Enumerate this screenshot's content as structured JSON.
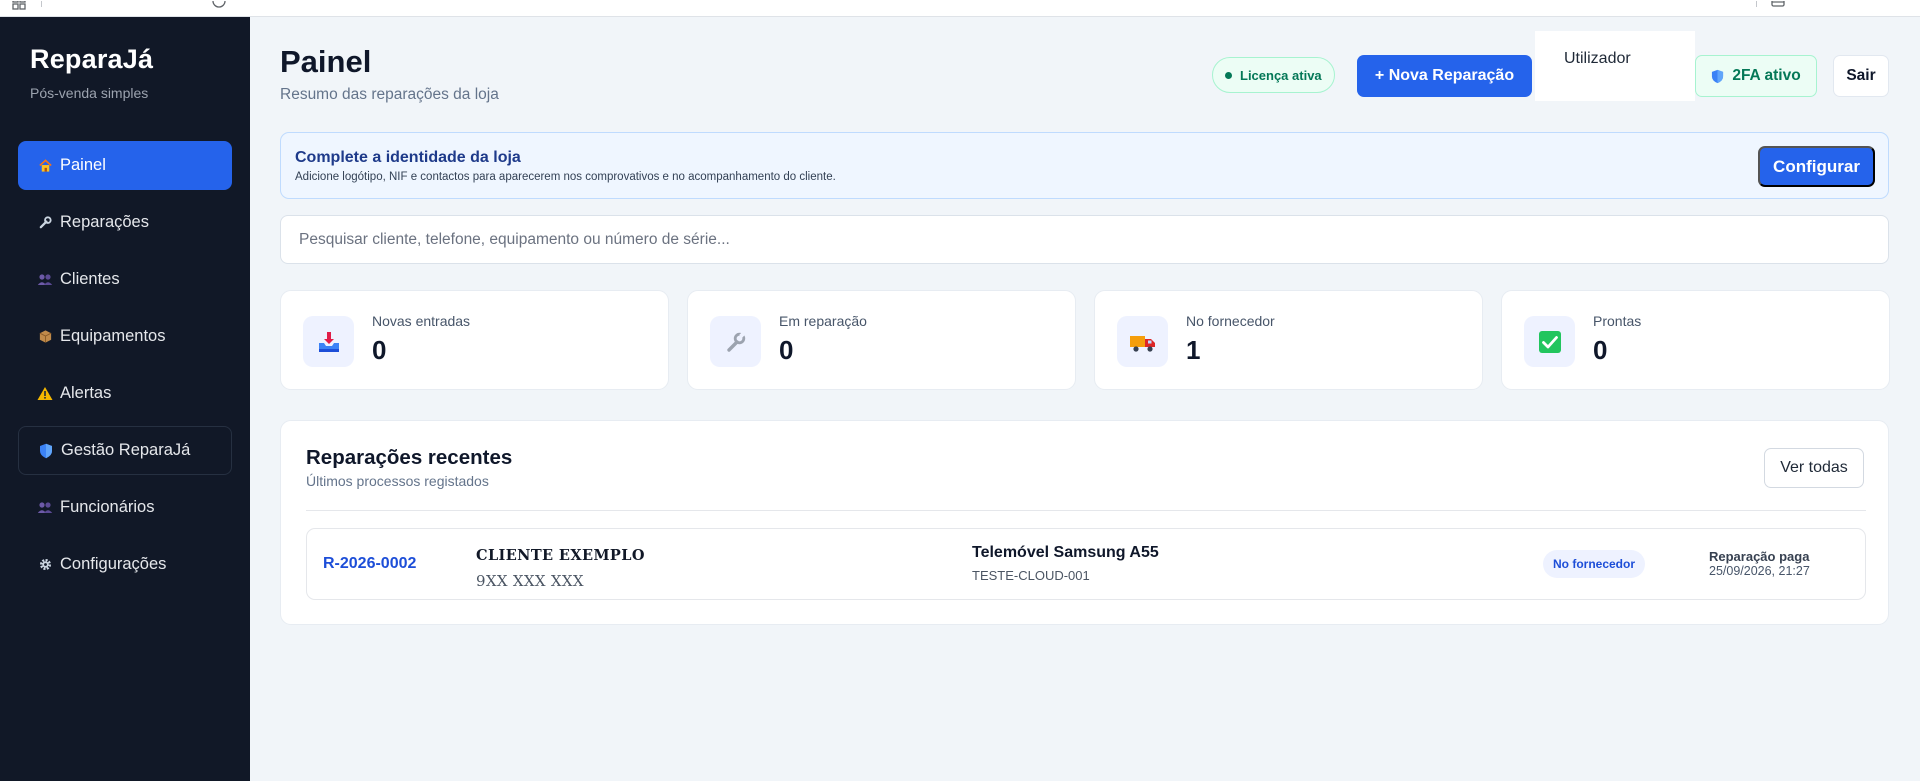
{
  "app": {
    "brand": "ReparaJá",
    "tagline": "Pós-venda simples"
  },
  "sidebar": {
    "items": [
      {
        "label": "Painel",
        "icon": "house-icon"
      },
      {
        "label": "Reparações",
        "icon": "wrench-icon"
      },
      {
        "label": "Clientes",
        "icon": "people-icon"
      },
      {
        "label": "Equipamentos",
        "icon": "package-icon"
      },
      {
        "label": "Alertas",
        "icon": "warning-icon"
      },
      {
        "label": "Gestão ReparaJá",
        "icon": "shield-icon"
      },
      {
        "label": "Funcionários",
        "icon": "people-icon"
      },
      {
        "label": "Configurações",
        "icon": "gear-icon"
      }
    ],
    "active": "Painel"
  },
  "header": {
    "title": "Painel",
    "subtitle": "Resumo das reparações da loja",
    "license_badge": "Licença ativa",
    "new_repair_button": "+ Nova Reparação",
    "user_label": "Utilizador",
    "twofa_badge": "2FA ativo",
    "logout_button": "Sair"
  },
  "banner": {
    "title": "Complete a identidade da loja",
    "text": "Adicione logótipo, NIF e contactos para aparecerem nos comprovativos e no acompanhamento do cliente.",
    "button": "Configurar"
  },
  "search": {
    "placeholder": "Pesquisar cliente, telefone, equipamento ou número de série...",
    "value": ""
  },
  "stats": [
    {
      "label": "Novas entradas",
      "value": "0",
      "icon": "inbox-tray-icon"
    },
    {
      "label": "Em reparação",
      "value": "0",
      "icon": "wrench-icon"
    },
    {
      "label": "No fornecedor",
      "value": "1",
      "icon": "delivery-truck-icon"
    },
    {
      "label": "Prontas",
      "value": "0",
      "icon": "check-mark-icon"
    }
  ],
  "recent": {
    "title": "Reparações recentes",
    "subtitle": "Últimos processos registados",
    "view_all_button": "Ver todas",
    "rows": [
      {
        "ref": "R-2026-0002",
        "client": "CLIENTE EXEMPLO",
        "phone": "9XX XXX XXX",
        "device": "Telemóvel Samsung A55",
        "serial": "TESTE-CLOUD-001",
        "status": "No fornecedor",
        "payment": "Reparação paga",
        "datetime": "25/09/2026, 21:27"
      }
    ]
  },
  "colors": {
    "sidebar_bg": "#111827",
    "accent": "#2563eb",
    "success": "#047857",
    "page_bg": "#f1f5f9"
  }
}
